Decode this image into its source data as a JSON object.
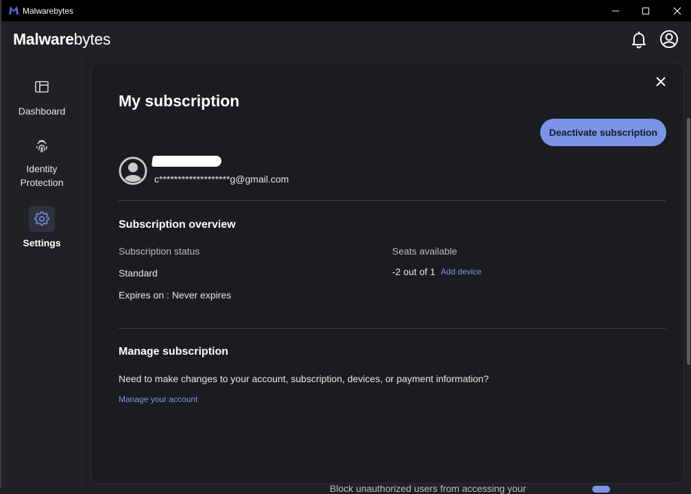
{
  "window": {
    "title": "Malwarebytes",
    "minimize_icon": "minimize-icon",
    "maximize_icon": "maximize-icon",
    "close_icon": "close-icon"
  },
  "header": {
    "logo_bold": "M",
    "logo_rest_bold": "alware",
    "logo_rest": "bytes",
    "notifications_icon": "bell-icon",
    "account_icon": "account-circle-icon"
  },
  "sidebar": {
    "items": [
      {
        "label": "Dashboard",
        "icon": "dashboard-icon",
        "active": false
      },
      {
        "label": "Identity\nProtection",
        "icon": "fingerprint-icon",
        "active": false
      },
      {
        "label": "Settings",
        "icon": "gear-icon",
        "active": true
      }
    ]
  },
  "subscription": {
    "title": "My subscription",
    "deactivate_label": "Deactivate subscription",
    "email": "c*******************g@gmail.com",
    "overview": {
      "title": "Subscription overview",
      "status_label": "Subscription status",
      "status_value": "Standard",
      "expires_value": "Expires on : Never expires",
      "seats_label": "Seats available",
      "seats_value": "-2 out of 1",
      "add_device_label": "Add device"
    },
    "manage": {
      "title": "Manage subscription",
      "description": "Need to make changes to your account, subscription, devices, or payment information?",
      "link_label": "Manage your account"
    }
  },
  "background": {
    "partial_text": "Block unauthorized users from accessing your"
  },
  "colors": {
    "accent": "#7b93e6",
    "background": "#202124",
    "panel": "#1b1c1f",
    "titlebar": "#000000"
  }
}
